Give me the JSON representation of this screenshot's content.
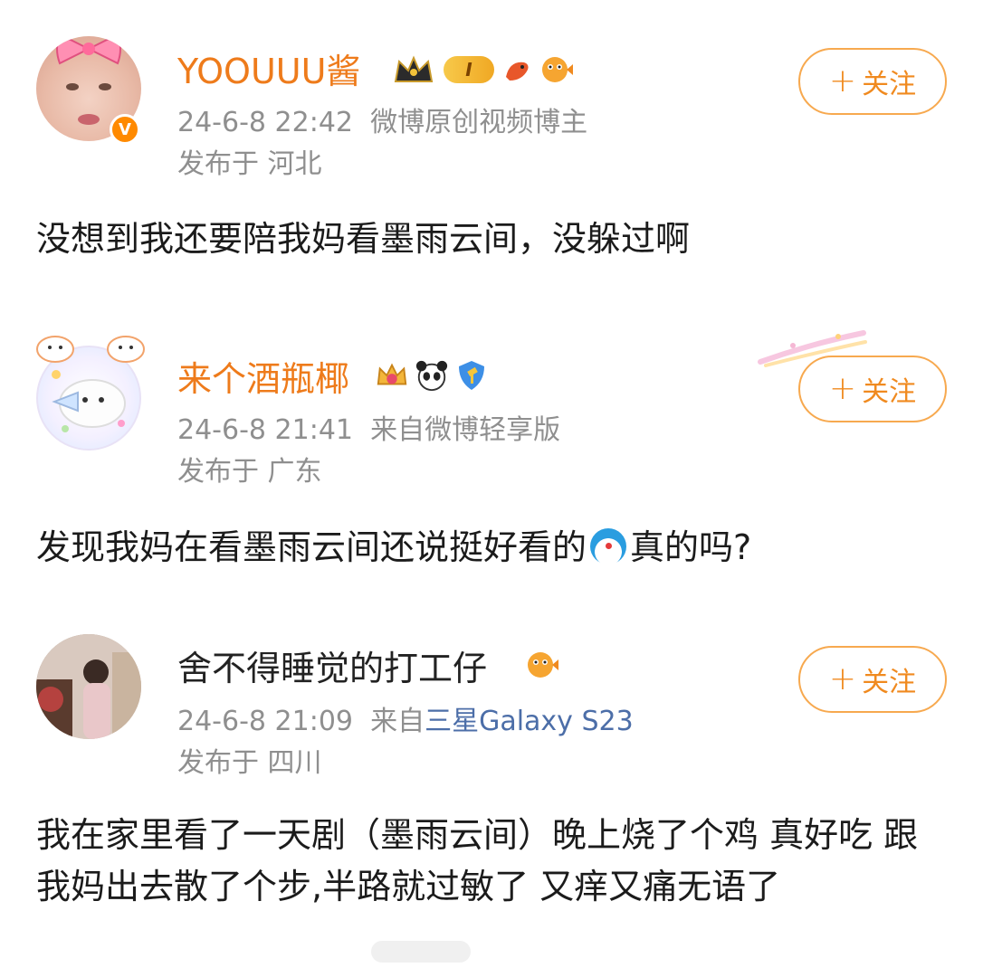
{
  "posts": [
    {
      "username": "YOOUUU酱",
      "time": "24-6-8 22:42",
      "source": "微博原创视频博主",
      "location": "发布于 河北",
      "follow_label": "关注",
      "content": "没想到我还要陪我妈看墨雨云间，没躲过啊",
      "badges": [
        "crown-badge-icon",
        "level-badge-icon",
        "fish-icon",
        "pufferfish-icon"
      ],
      "level_text": "I"
    },
    {
      "username": "来个酒瓶椰",
      "time": "24-6-8 21:41",
      "source": "来自微博轻享版",
      "location": "发布于 广东",
      "follow_label": "关注",
      "content_before": "发现我妈在看墨雨云间还说挺好看的",
      "content_after": "真的吗?",
      "badges": [
        "crown-2-icon",
        "panda-icon",
        "hammer-shield-icon"
      ]
    },
    {
      "username": "舍不得睡觉的打工仔",
      "time": "24-6-8 21:09",
      "source_prefix": "来自",
      "source_link": "三星Galaxy S23",
      "location": "发布于 四川",
      "follow_label": "关注",
      "content": "我在家里看了一天剧（墨雨云间）晚上烧了个鸡 真好吃 跟我妈出去散了个步,半路就过敏了 又痒又痛无语了",
      "badges": [
        "pufferfish-icon"
      ]
    }
  ],
  "colors": {
    "accent": "#ee7b1b",
    "follow_border": "#f7a94f",
    "meta_gray": "#8f8f8f",
    "link_blue": "#4c6ea8"
  }
}
